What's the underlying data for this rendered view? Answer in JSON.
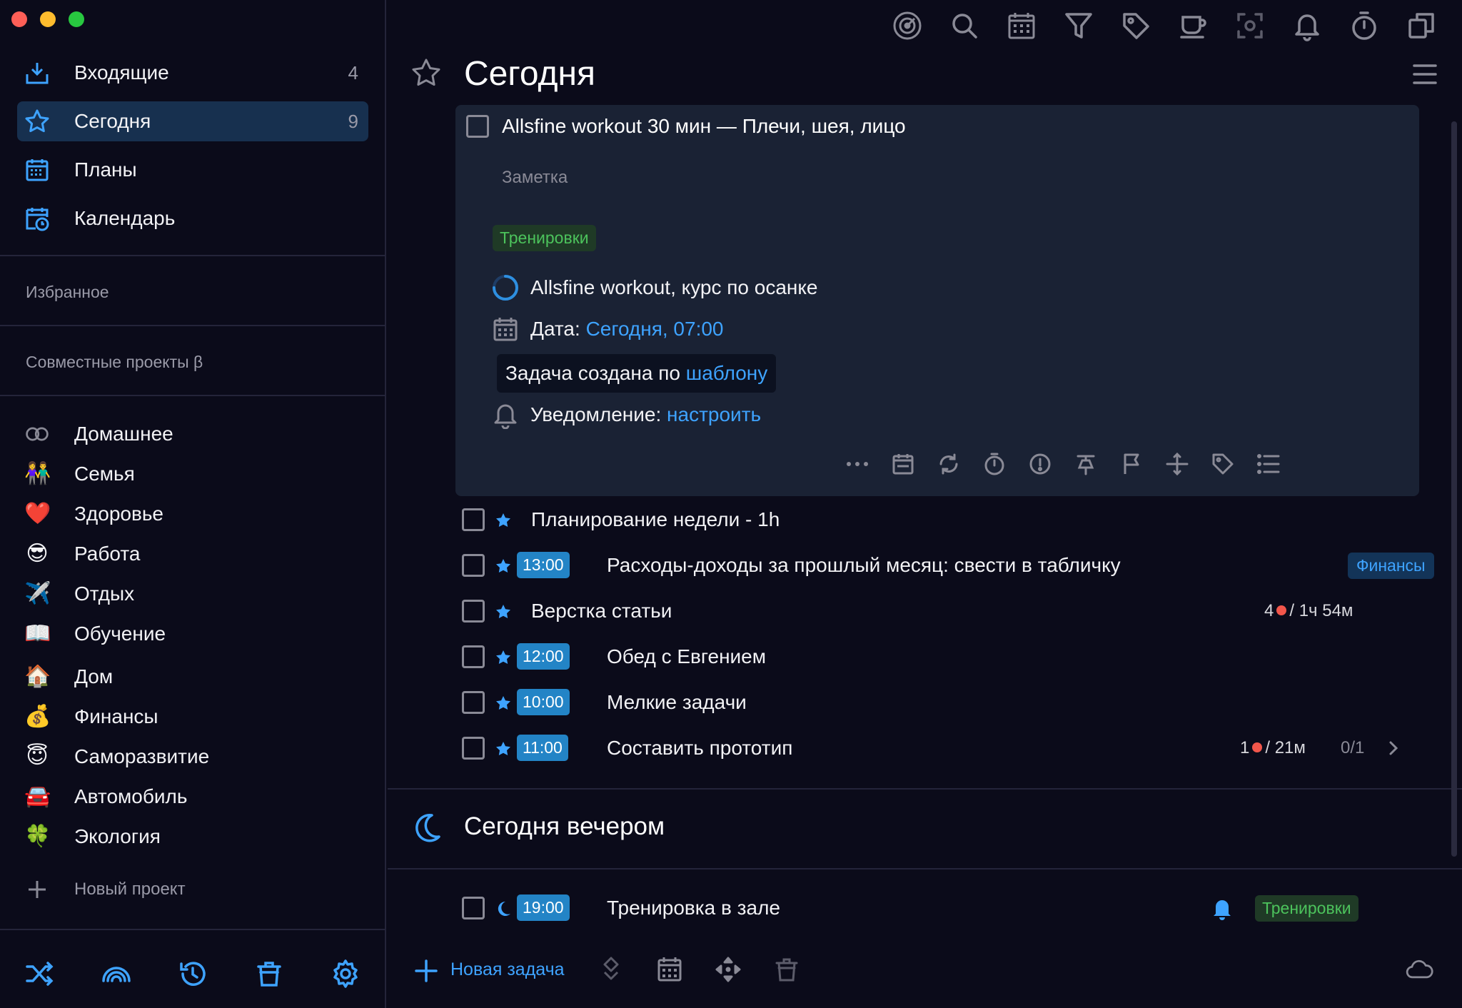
{
  "sidebar": {
    "nav": [
      {
        "label": "Входящие",
        "count": "4",
        "icon": "inbox-icon"
      },
      {
        "label": "Сегодня",
        "count": "9",
        "icon": "star-icon"
      },
      {
        "label": "Планы",
        "count": "",
        "icon": "calendar-icon"
      },
      {
        "label": "Календарь",
        "count": "",
        "icon": "calendar-clock-icon"
      }
    ],
    "favorites_header": "Избранное",
    "shared_header": "Совместные проекты β",
    "projects": [
      {
        "label": "Домашнее",
        "icon": "loop-icon",
        "emoji": ""
      },
      {
        "label": "Семья",
        "icon": "family-emoji-icon",
        "emoji": "👫"
      },
      {
        "label": "Здоровье",
        "icon": "heart-emoji-icon",
        "emoji": "❤️"
      },
      {
        "label": "Работа",
        "icon": "sunglasses-emoji-icon",
        "emoji": "😎"
      },
      {
        "label": "Отдых",
        "icon": "airplane-emoji-icon",
        "emoji": "✈️"
      },
      {
        "label": "Обучение",
        "icon": "book-emoji-icon",
        "emoji": "📖"
      },
      {
        "label": "Дом",
        "icon": "house-emoji-icon",
        "emoji": "🏠"
      },
      {
        "label": "Финансы",
        "icon": "money-bag-emoji-icon",
        "emoji": "💰"
      },
      {
        "label": "Саморазвитие",
        "icon": "angel-emoji-icon",
        "emoji": "😇"
      },
      {
        "label": "Автомобиль",
        "icon": "car-emoji-icon",
        "emoji": "🚘"
      },
      {
        "label": "Экология",
        "icon": "clover-emoji-icon",
        "emoji": "🍀"
      }
    ],
    "new_project_label": "Новый проект",
    "bottom_icons": [
      "shuffle-icon",
      "rainbow-icon",
      "history-icon",
      "trash-icon",
      "settings-icon"
    ]
  },
  "toolbar": {
    "icons": [
      "focus-icon",
      "search-icon",
      "calendar-icon",
      "filter-icon",
      "tag-icon",
      "coffee-icon",
      "scan-icon",
      "bell-icon",
      "timer-icon",
      "windows-icon"
    ]
  },
  "page_title": "Сегодня",
  "expanded_task": {
    "title": "Allsfine workout 30 мин — Плечи, шея, лицо",
    "note_placeholder": "Заметка",
    "tag": "Тренировки",
    "project": "Allsfine workout, курс по осанке",
    "date_label": "Дата:",
    "date_value": "Сегодня, 07:00",
    "template_text": "Задача создана по",
    "template_link": "шаблону",
    "notification_label": "Уведомление:",
    "notification_link": "настроить"
  },
  "tasks": [
    {
      "title": "Планирование недели - 1h",
      "time": ""
    },
    {
      "title": "Расходы-доходы за прошлый месяц: свести в табличку",
      "time": "13:00",
      "tag": "Финансы"
    },
    {
      "title": "Верстка статьи",
      "time": "",
      "pomodoros": "4",
      "duration": "/ 1ч 54м"
    },
    {
      "title": "Обед с Евгением",
      "time": "12:00"
    },
    {
      "title": "Мелкие задачи",
      "time": "10:00"
    },
    {
      "title": "Составить прототип",
      "time": "11:00",
      "pomodoros": "1",
      "duration": "/ 21м",
      "subtasks": "0/1"
    }
  ],
  "evening_section": {
    "title": "Сегодня вечером",
    "task": {
      "title": "Тренировка в зале",
      "time": "19:00",
      "tag": "Тренировки"
    }
  },
  "bottom_bar": {
    "new_task_label": "Новая задача"
  },
  "colors": {
    "accent": "#3ea3ff",
    "background": "#0b0b1a",
    "card": "#1a2234",
    "active_nav": "#17304f",
    "time_badge": "#2384c6",
    "tag_green": "#4cc35c",
    "pomodoro": "#f2564b"
  }
}
